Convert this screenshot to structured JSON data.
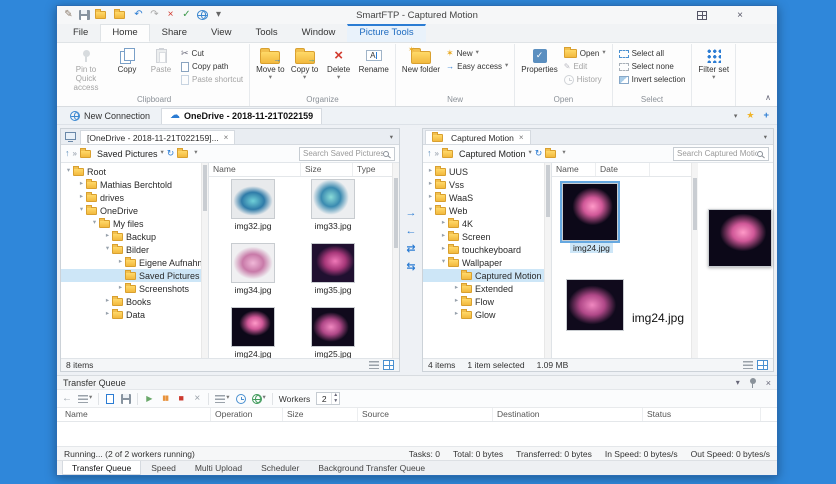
{
  "window": {
    "title": "SmartFTP - Captured Motion"
  },
  "icons": {
    "cloud": "☁",
    "close": "×",
    "check": "✓",
    "chevron_down": "▾",
    "collapse": "∧",
    "chevrons": "»",
    "up": "↑",
    "refresh": "↻",
    "back": "←",
    "scissors": "✂",
    "star": "★",
    "sparkle": "✶",
    "arrow_right": "→",
    "arrow_left": "←",
    "arrow_swap": "⇄",
    "arrow_swap2": "⇆",
    "play": "▶",
    "pause": "▮▮",
    "stop": "■",
    "plus": "+",
    "edit": "✎"
  },
  "titlebar": {
    "quick_access": [
      {
        "name": "edit-icon",
        "glyph": "✎",
        "color": "#8a7a6a"
      },
      {
        "name": "save-icon",
        "glyph": "",
        "color": ""
      },
      {
        "name": "new-folder-icon",
        "glyph": "",
        "color": ""
      },
      {
        "name": "open-folder-icon",
        "glyph": "",
        "color": ""
      },
      {
        "name": "undo-icon",
        "glyph": "↶",
        "color": "#2b7cd3"
      },
      {
        "name": "redo-icon",
        "glyph": "↷",
        "color": "#a8a8a8"
      },
      {
        "name": "delete-icon",
        "glyph": "×",
        "color": "#d23b2f"
      },
      {
        "name": "check-icon",
        "glyph": "✓",
        "color": "#3f9a4d"
      },
      {
        "name": "globe-icon",
        "glyph": "",
        "color": ""
      },
      {
        "name": "toolbar-menu-icon",
        "glyph": "▾",
        "color": "#666666"
      }
    ]
  },
  "ribbon": {
    "tabs": [
      {
        "label": "File"
      },
      {
        "label": "Home",
        "active": true
      },
      {
        "label": "Share"
      },
      {
        "label": "View"
      },
      {
        "label": "Tools"
      },
      {
        "label": "Window"
      },
      {
        "label": "Picture Tools",
        "context": true
      }
    ],
    "clipboard": {
      "label": "Clipboard",
      "pin": "Pin to Quick access",
      "copy": "Copy",
      "paste": "Paste",
      "cut": "Cut",
      "copy_path": "Copy path",
      "paste_shortcut": "Paste shortcut"
    },
    "organize": {
      "label": "Organize",
      "move_to": "Move to",
      "copy_to": "Copy to",
      "delete": "Delete",
      "rename": "Rename"
    },
    "new_group": {
      "label": "New",
      "new_folder": "New folder",
      "new_item": "New",
      "easy_access": "Easy access"
    },
    "open_group": {
      "label": "Open",
      "properties": "Properties",
      "open": "Open",
      "edit": "Edit",
      "history": "History"
    },
    "select_group": {
      "label": "Select",
      "select_all": "Select all",
      "select_none": "Select none",
      "invert": "Invert selection"
    },
    "filter_group": {
      "filter_set": "Filter set"
    }
  },
  "connection_bar": {
    "tabs": [
      {
        "label": "New Connection"
      },
      {
        "label": "OneDrive - 2018-11-21T022159"
      }
    ]
  },
  "left_pane": {
    "tab": "[OneDrive - 2018-11-21T022159]...",
    "address": "Saved Pictures",
    "search_placeholder": "Search Saved Pictures",
    "columns": [
      "Name",
      "Size",
      "Type"
    ],
    "tree": [
      {
        "label": "Root",
        "level": 0,
        "arrow": "▾"
      },
      {
        "label": "Mathias Berchtold",
        "level": 1,
        "arrow": "▸"
      },
      {
        "label": "drives",
        "level": 1,
        "arrow": "▸"
      },
      {
        "label": "OneDrive",
        "level": 1,
        "arrow": "▾"
      },
      {
        "label": "My files",
        "level": 2,
        "arrow": "▾"
      },
      {
        "label": "Backup",
        "level": 3,
        "arrow": "▸"
      },
      {
        "label": "Bilder",
        "level": 3,
        "arrow": "▾"
      },
      {
        "label": "Eigene Aufnahmen",
        "level": 4,
        "arrow": "▸"
      },
      {
        "label": "Saved Pictures",
        "level": 4,
        "arrow": "",
        "selected": true
      },
      {
        "label": "Screenshots",
        "level": 4,
        "arrow": "▸"
      },
      {
        "label": "Books",
        "level": 3,
        "arrow": "▸"
      },
      {
        "label": "Data",
        "level": 3,
        "arrow": "▸"
      }
    ],
    "files": [
      {
        "name": "img32.jpg",
        "thumb": "teal"
      },
      {
        "name": "img33.jpg",
        "thumb": "teal2"
      },
      {
        "name": "img34.jpg",
        "thumb": "pink"
      },
      {
        "name": "img35.jpg",
        "thumb": "darkpink"
      },
      {
        "name": "img24.jpg",
        "thumb": "lily"
      },
      {
        "name": "img25.jpg",
        "thumb": "lily2"
      }
    ],
    "status": "8 items"
  },
  "right_pane": {
    "tab": "Captured Motion",
    "address": "Captured Motion",
    "search_placeholder": "Search Captured Motion",
    "columns": [
      "Name",
      "Date"
    ],
    "tree": [
      {
        "label": "UUS",
        "level": 0,
        "arrow": "▸"
      },
      {
        "label": "Vss",
        "level": 0,
        "arrow": "▸"
      },
      {
        "label": "WaaS",
        "level": 0,
        "arrow": "▸"
      },
      {
        "label": "Web",
        "level": 0,
        "arrow": "▾"
      },
      {
        "label": "4K",
        "level": 1,
        "arrow": "▸"
      },
      {
        "label": "Screen",
        "level": 1,
        "arrow": "▸"
      },
      {
        "label": "touchkeyboard",
        "level": 1,
        "arrow": "▸"
      },
      {
        "label": "Wallpaper",
        "level": 1,
        "arrow": "▾"
      },
      {
        "label": "Captured Motion",
        "level": 2,
        "arrow": "",
        "selected": true
      },
      {
        "label": "Extended",
        "level": 2,
        "arrow": "▸"
      },
      {
        "label": "Flow",
        "level": 2,
        "arrow": "▸"
      },
      {
        "label": "Glow",
        "level": 2,
        "arrow": "▸"
      }
    ],
    "files": [
      {
        "name": "img24.jpg",
        "thumb": "lily",
        "selected": true
      }
    ],
    "drag_ghost_name": "img24.jpg",
    "status_items": "4 items",
    "status_selected": "1 item selected",
    "status_size": "1.09 MB"
  },
  "transfer_queue": {
    "title": "Transfer Queue",
    "workers_label": "Workers",
    "workers_value": "2",
    "columns": [
      "Name",
      "Operation",
      "Size",
      "Source",
      "Destination",
      "Status"
    ],
    "status_left": "Running... (2 of 2 workers running)",
    "status_fields": [
      "Tasks: 0",
      "Total: 0 bytes",
      "Transferred: 0 bytes",
      "In Speed: 0 bytes/s",
      "Out Speed: 0 bytes/s"
    ]
  },
  "bottom_tabs": [
    "Transfer Queue",
    "Speed",
    "Multi Upload",
    "Scheduler",
    "Background Transfer Queue"
  ],
  "colors": {
    "accent": "#2b7cd3",
    "desktop": "#2f87da",
    "selection": "#cde6f7"
  }
}
